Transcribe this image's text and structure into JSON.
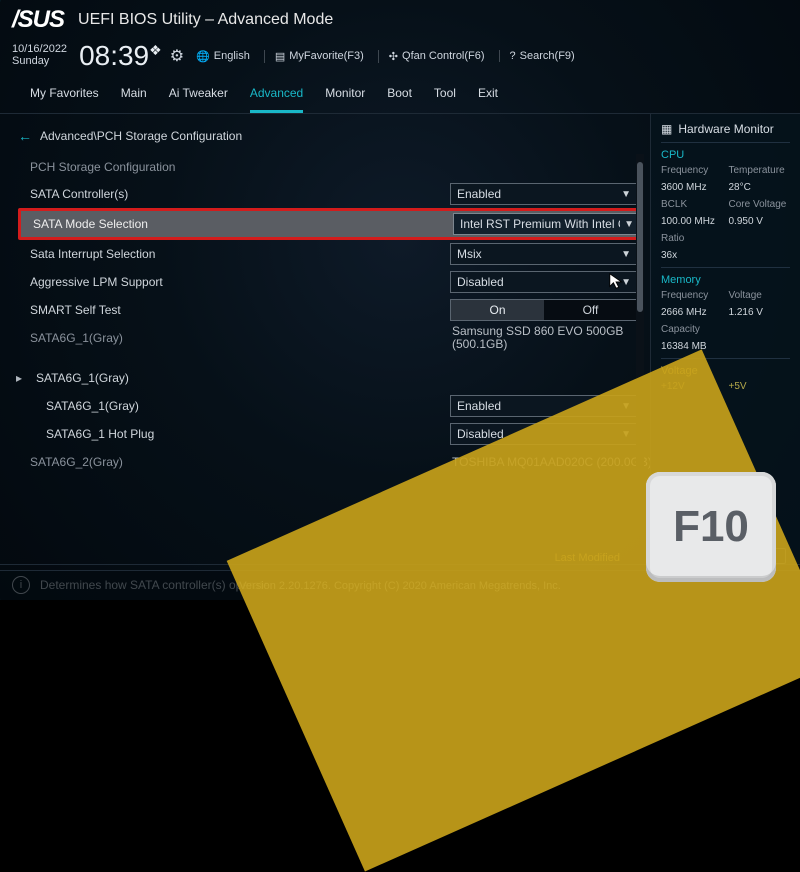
{
  "brand": "/SUS",
  "app_title": "UEFI BIOS Utility – Advanced Mode",
  "date": "10/16/2022",
  "day": "Sunday",
  "time": "08:39",
  "ampm": "❖",
  "toolbar": {
    "lang": "English",
    "fav": "MyFavorite(F3)",
    "qfan": "Qfan Control(F6)",
    "search": "Search(F9)"
  },
  "tabs": [
    "My Favorites",
    "Main",
    "Ai Tweaker",
    "Advanced",
    "Monitor",
    "Boot",
    "Tool",
    "Exit"
  ],
  "active_tab_index": 3,
  "breadcrumb": "Advanced\\PCH Storage Configuration",
  "section_label": "PCH Storage Configuration",
  "settings": {
    "sata_controllers": {
      "label": "SATA Controller(s)",
      "value": "Enabled"
    },
    "sata_mode": {
      "label": "SATA Mode Selection",
      "value": "Intel RST Premium With Intel O"
    },
    "sata_int": {
      "label": "Sata Interrupt Selection",
      "value": "Msix"
    },
    "agg_lpm": {
      "label": "Aggressive LPM Support",
      "value": "Disabled"
    },
    "smart_self": {
      "label": "SMART Self Test",
      "on": "On",
      "off": "Off"
    },
    "port1_gray": {
      "label": "SATA6G_1(Gray)",
      "value": "Samsung SSD 860 EVO 500GB (500.1GB)"
    },
    "port1_expand": {
      "label": "SATA6G_1(Gray)"
    },
    "port1_sub": {
      "label": "SATA6G_1(Gray)",
      "value": "Enabled"
    },
    "port1_hot": {
      "label": "SATA6G_1 Hot Plug",
      "value": "Disabled"
    },
    "port2_gray": {
      "label": "SATA6G_2(Gray)",
      "value": "TOSHIBA MQ01AAD020C (200.0GB)"
    }
  },
  "help_text": "Determines how SATA controller(s) operate.",
  "hw_monitor": {
    "title": "Hardware Monitor",
    "cpu": "CPU",
    "freq_lbl": "Frequency",
    "freq": "3600 MHz",
    "temp_lbl": "Temperature",
    "temp": "28°C",
    "bclk_lbl": "BCLK",
    "bclk": "100.00 MHz",
    "vcore_lbl": "Core Voltage",
    "vcore": "0.950 V",
    "ratio_lbl": "Ratio",
    "ratio": "36x",
    "memory": "Memory",
    "mfreq_lbl": "Frequency",
    "mfreq": "2666 MHz",
    "mvolt_lbl": "Voltage",
    "mvolt": "1.216 V",
    "cap_lbl": "Capacity",
    "cap": "16384 MB",
    "voltage": "Voltage",
    "v12_lbl": "+12V",
    "v5_lbl": "+5V"
  },
  "last_modified": "Last Modified",
  "footer": "Version 2.20.1276. Copyright (C) 2020 American Megatrends, Inc.",
  "f10": "F10"
}
